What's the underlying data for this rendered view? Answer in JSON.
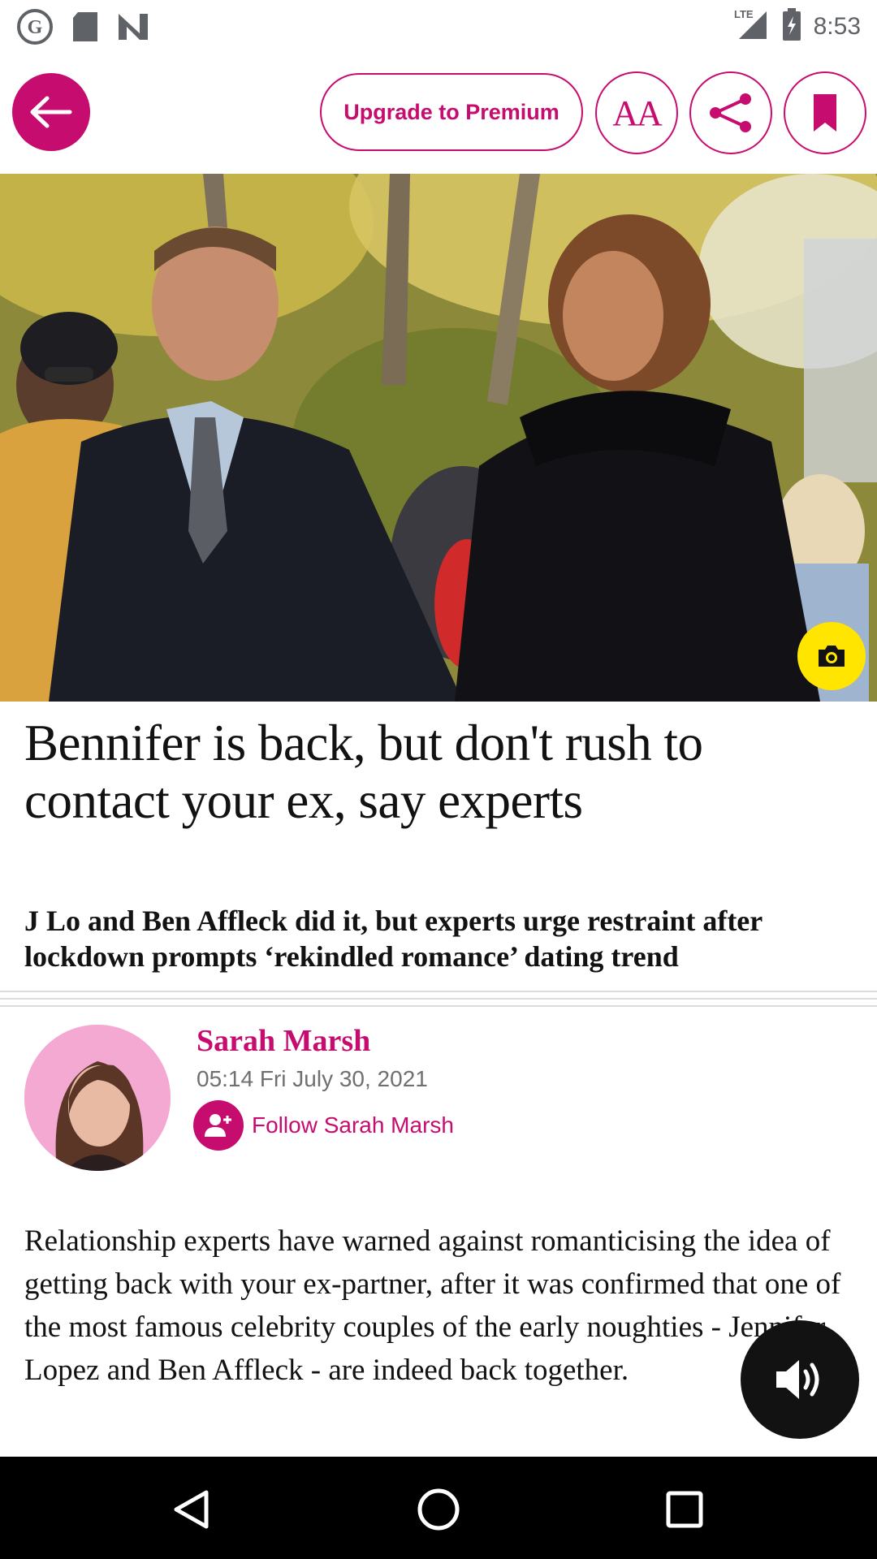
{
  "status_bar": {
    "time": "8:53",
    "network": "LTE",
    "icons": [
      "guardian-app-icon",
      "sd-card-icon",
      "n-app-icon",
      "signal-icon",
      "battery-icon"
    ]
  },
  "toolbar": {
    "back_icon": "arrow-left-icon",
    "upgrade_label": "Upgrade to Premium",
    "text_size_label": "AA",
    "share_icon": "share-icon",
    "bookmark_icon": "bookmark-icon"
  },
  "hero": {
    "camera_icon": "camera-icon"
  },
  "article": {
    "headline": "Bennifer is back, but don't rush to contact your ex, say experts",
    "standfirst": "J Lo and Ben Affleck did it, but experts urge restraint after lockdown prompts ‘rekindled romance’ dating trend",
    "author": "Sarah Marsh",
    "date": "05:14 Fri July 30, 2021",
    "follow_label": "Follow Sarah Marsh",
    "body": "Relationship experts have warned against romanticising the idea of getting back with your ex-partner, after it was confirmed that one of the most famous celebrity couples of the early noughties - Jennifer Lopez and Ben Affleck - are indeed back together."
  },
  "listen_icon": "volume-icon",
  "colors": {
    "accent": "#c70c6f",
    "camera_button": "#ffe500",
    "text": "#121212",
    "nav_bar": "#000000"
  }
}
